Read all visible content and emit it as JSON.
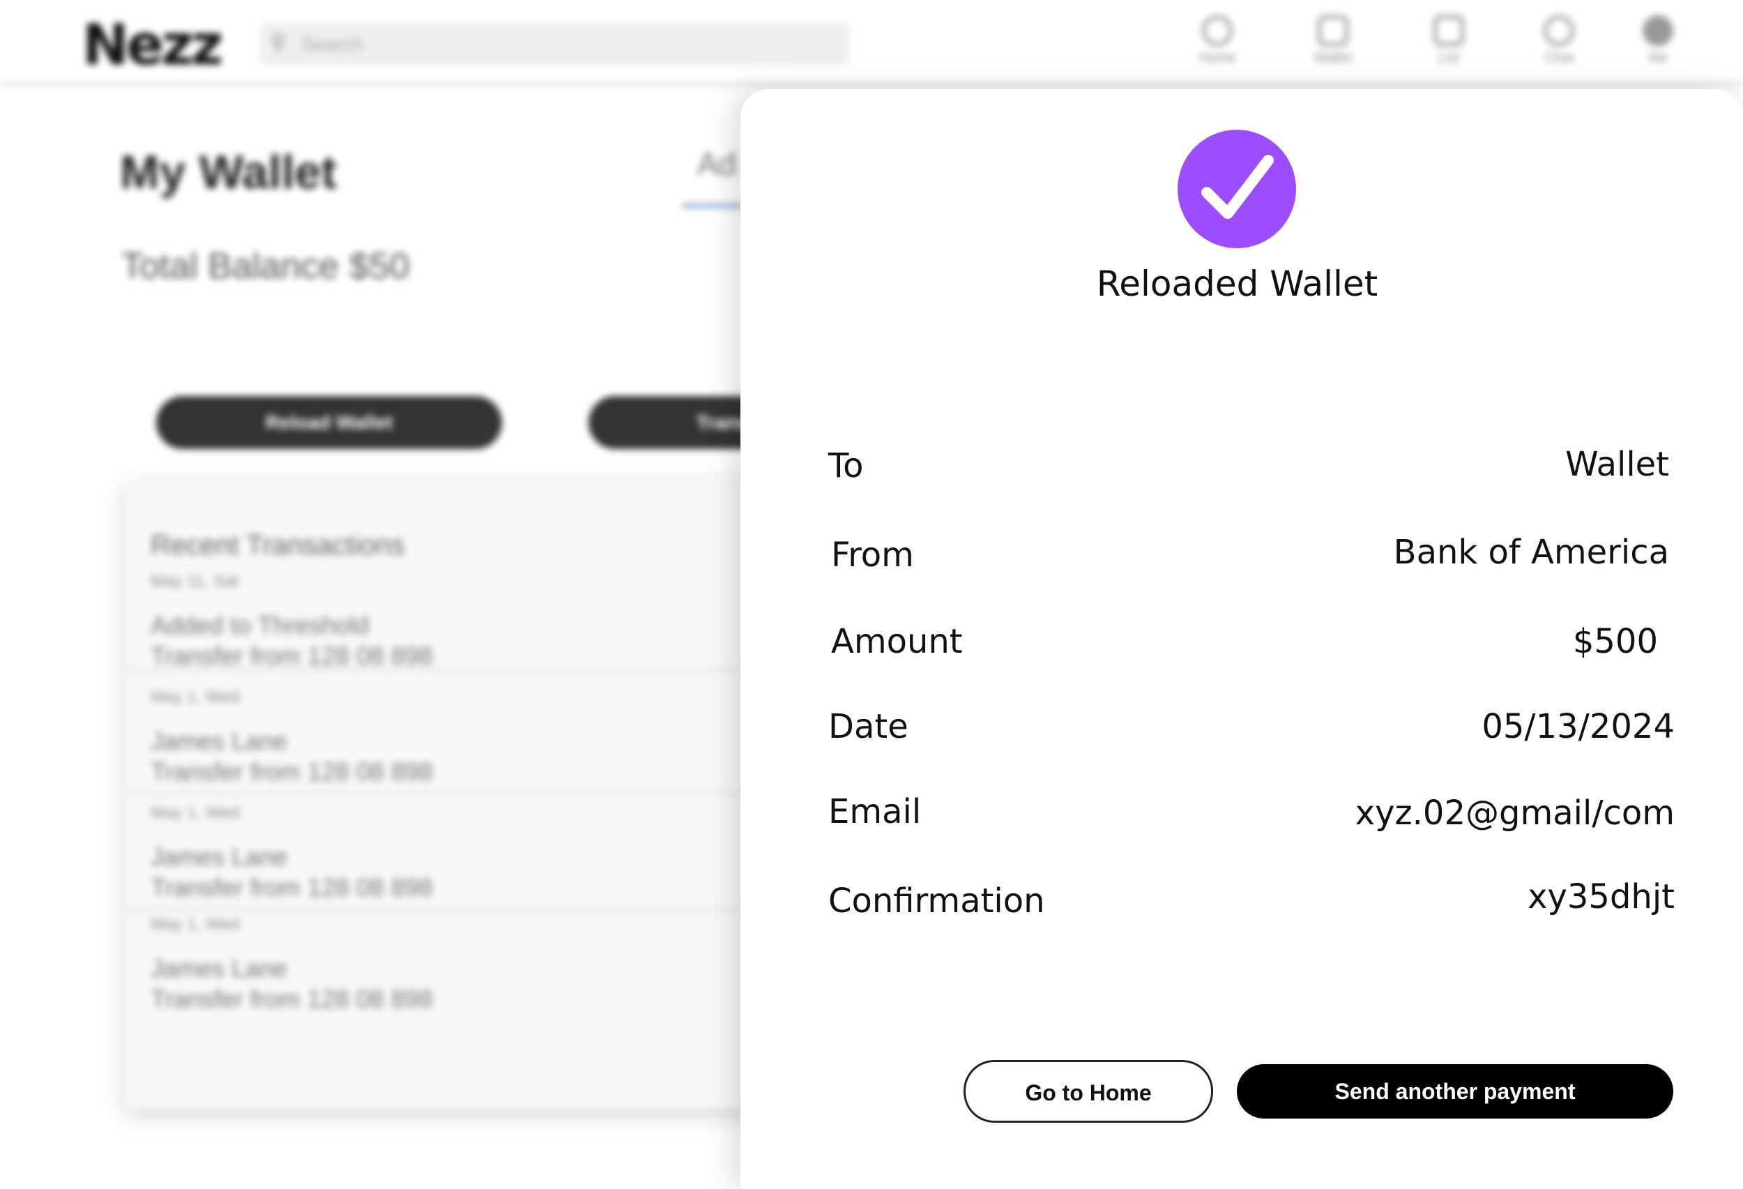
{
  "background": {
    "logo": "Nezz",
    "search": {
      "icon": "search-icon",
      "placeholder": "Search"
    },
    "nav": [
      {
        "label": "Home",
        "icon": "home-icon"
      },
      {
        "label": "Wallet",
        "icon": "wallet-icon"
      },
      {
        "label": "List",
        "icon": "list-icon"
      },
      {
        "label": "Chat",
        "icon": "chat-icon"
      },
      {
        "label": "Me",
        "icon": "profile-icon"
      }
    ],
    "page_title": "My Wallet",
    "balance": "Total Balance $50",
    "ad_label": "Ad",
    "reload_button": "Reload Wallet",
    "transfer_button": "Transfer",
    "transactions_title": "Recent Transactions",
    "transactions": [
      {
        "date": "May 11, Sat",
        "name": "Added to Threshold",
        "desc": "Transfer from 128 08 898"
      },
      {
        "date": "May 1, Wed",
        "name": "James Lane",
        "desc": "Transfer from 128 08 898"
      },
      {
        "date": "May 1, Wed",
        "name": "James Lane",
        "desc": "Transfer from 128 08 898"
      },
      {
        "date": "May 1, Wed",
        "name": "James Lane",
        "desc": "Transfer from 128 08 898"
      }
    ]
  },
  "modal": {
    "status_icon": "check-circle-icon",
    "accent_color": "#9b4dff",
    "title": "Reloaded Wallet",
    "details": {
      "to": {
        "label": "To",
        "value": "Wallet"
      },
      "from": {
        "label": "From",
        "value": "Bank of America"
      },
      "amount": {
        "label": "Amount",
        "value": "$500"
      },
      "date": {
        "label": "Date",
        "value": "05/13/2024"
      },
      "email": {
        "label": "Email",
        "value": "xyz.02@gmail/com"
      },
      "confirmation": {
        "label": "Confirmation",
        "value": "xy35dhjt"
      }
    },
    "home_button": "Go to Home",
    "send_button": "Send another payment"
  }
}
